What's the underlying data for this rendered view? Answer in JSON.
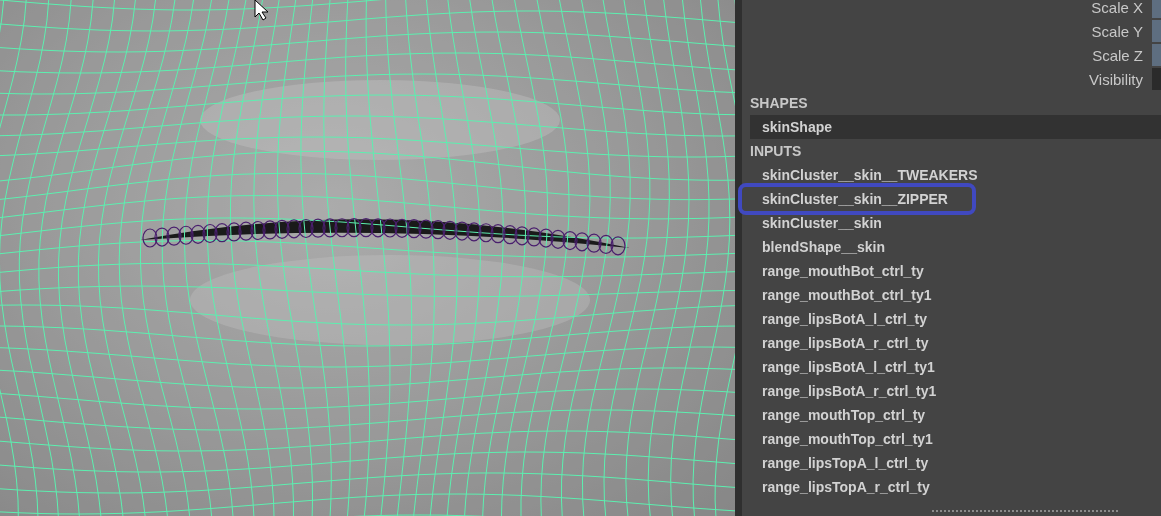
{
  "channel_box": {
    "attributes": [
      {
        "label": "Scale X",
        "kind": "keyed"
      },
      {
        "label": "Scale Y",
        "kind": "keyed"
      },
      {
        "label": "Scale Z",
        "kind": "keyed"
      },
      {
        "label": "Visibility",
        "kind": "plain"
      }
    ]
  },
  "shapes": {
    "heading": "SHAPES",
    "items": [
      {
        "label": "skinShape",
        "selected": true
      }
    ]
  },
  "inputs": {
    "heading": "INPUTS",
    "items": [
      {
        "label": "skinCluster__skin__TWEAKERS",
        "highlighted": false
      },
      {
        "label": "skinCluster__skin__ZIPPER",
        "highlighted": true
      },
      {
        "label": "skinCluster__skin",
        "highlighted": false
      },
      {
        "label": "blendShape__skin",
        "highlighted": false
      },
      {
        "label": "range_mouthBot_ctrl_ty",
        "highlighted": false
      },
      {
        "label": "range_mouthBot_ctrl_ty1",
        "highlighted": false
      },
      {
        "label": "range_lipsBotA_l_ctrl_ty",
        "highlighted": false
      },
      {
        "label": "range_lipsBotA_r_ctrl_ty",
        "highlighted": false
      },
      {
        "label": "range_lipsBotA_l_ctrl_ty1",
        "highlighted": false
      },
      {
        "label": "range_lipsBotA_r_ctrl_ty1",
        "highlighted": false
      },
      {
        "label": "range_mouthTop_ctrl_ty",
        "highlighted": false
      },
      {
        "label": "range_mouthTop_ctrl_ty1",
        "highlighted": false
      },
      {
        "label": "range_lipsTopA_l_ctrl_ty",
        "highlighted": false
      },
      {
        "label": "range_lipsTopA_r_ctrl_ty",
        "highlighted": false
      }
    ]
  }
}
